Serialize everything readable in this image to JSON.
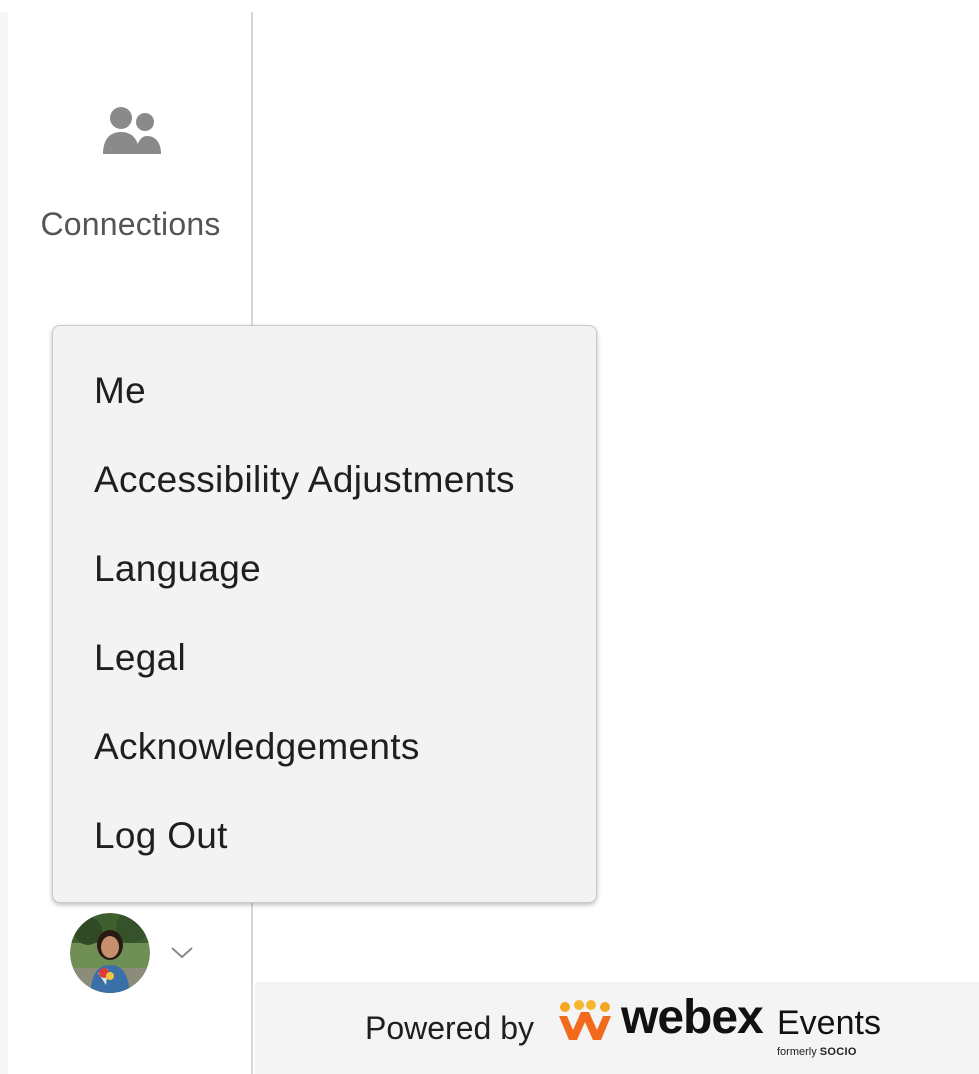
{
  "sidebar": {
    "nav_items": [
      {
        "label": "Connections",
        "icon": "people-icon"
      }
    ]
  },
  "user_menu": {
    "items": [
      {
        "label": "Me"
      },
      {
        "label": "Accessibility Adjustments"
      },
      {
        "label": "Language"
      },
      {
        "label": "Legal"
      },
      {
        "label": "Acknowledgements"
      },
      {
        "label": "Log Out"
      }
    ]
  },
  "user": {
    "avatar_icon": "user-avatar",
    "toggle_icon": "chevron-down-icon"
  },
  "footer": {
    "powered_by": "Powered by",
    "brand": "webex",
    "brand_suffix": "Events",
    "formerly_prefix": "formerly",
    "formerly_brand": "SOCIO"
  },
  "colors": {
    "menu_background": "#f3f3f3",
    "footer_background": "#f4f4f4",
    "nav_label": "#555555",
    "logo_orange": "#f26b1d",
    "logo_yellow": "#f5a623"
  }
}
